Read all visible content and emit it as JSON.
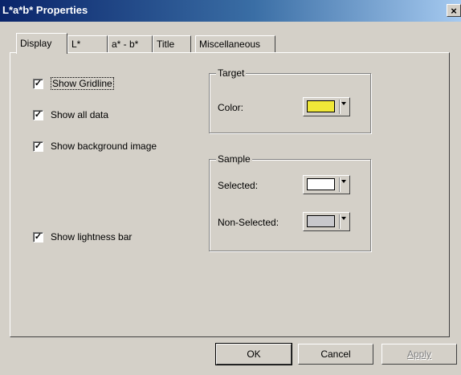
{
  "window": {
    "title": "L*a*b* Properties",
    "close_glyph": "×"
  },
  "tabs": [
    {
      "label": "Display"
    },
    {
      "label": "L*"
    },
    {
      "label": "a* - b*"
    },
    {
      "label": "Title"
    },
    {
      "label": "Miscellaneous"
    }
  ],
  "display": {
    "show_gridline": {
      "label": "Show Gridline",
      "checked": true
    },
    "show_all_data": {
      "label": "Show all data",
      "checked": true
    },
    "show_background_image": {
      "label": "Show background image",
      "checked": true
    },
    "show_lightness_bar": {
      "label": "Show lightness bar",
      "checked": true
    },
    "check_glyph": "✓"
  },
  "target": {
    "title": "Target",
    "color_label": "Color:",
    "color": "#f0e838"
  },
  "sample": {
    "title": "Sample",
    "selected_label": "Selected:",
    "selected_color": "#ffffff",
    "nonselected_label": "Non-Selected:",
    "nonselected_color": "#c8c8cc"
  },
  "buttons": {
    "ok": "OK",
    "cancel": "Cancel",
    "apply": "Apply"
  }
}
